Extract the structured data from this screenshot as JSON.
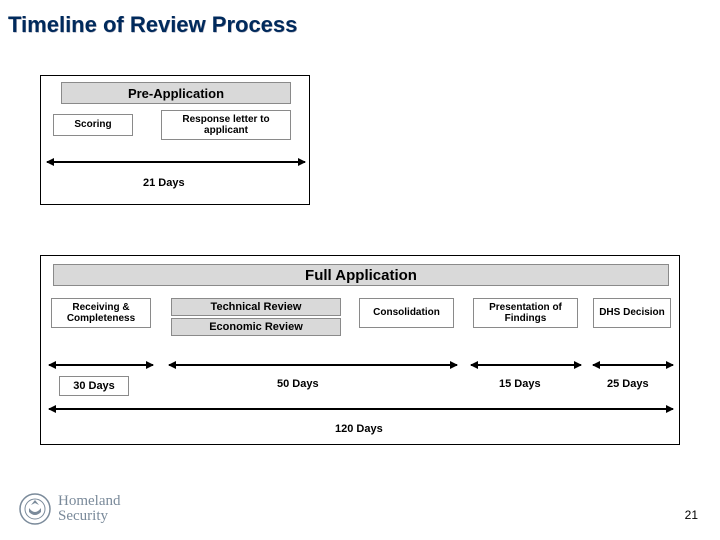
{
  "title": "Timeline of Review Process",
  "pre": {
    "header": "Pre-Application",
    "scoring": "Scoring",
    "response": "Response letter to applicant",
    "duration": "21 Days"
  },
  "full": {
    "header": "Full  Application",
    "receiving": "Receiving & Completeness",
    "technical": "Technical Review",
    "economic": "Economic Review",
    "consolidation": "Consolidation",
    "presentation": "Presentation of Findings",
    "decision": "DHS Decision",
    "d30": "30 Days",
    "d50": "50 Days",
    "d15": "15 Days",
    "d25": "25 Days",
    "d120": "120 Days"
  },
  "footer": {
    "org1": "Homeland",
    "org2": "Security",
    "page": "21"
  }
}
